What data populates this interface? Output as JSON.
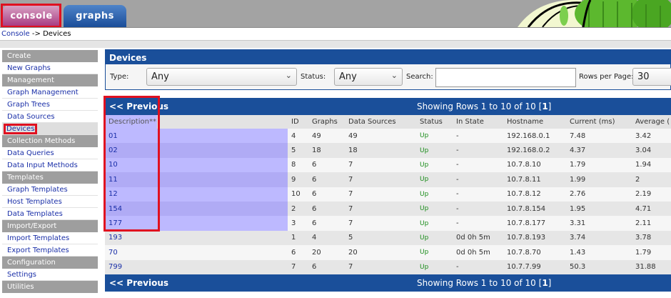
{
  "tabs": [
    {
      "label": "console",
      "active": true
    },
    {
      "label": "graphs",
      "active": false
    }
  ],
  "breadcrumb": {
    "root": "Console",
    "separator": "->",
    "current": "Devices"
  },
  "sidebar": [
    {
      "type": "header",
      "label": "Create"
    },
    {
      "type": "item",
      "label": "New Graphs"
    },
    {
      "type": "header",
      "label": "Management"
    },
    {
      "type": "item",
      "label": "Graph Management"
    },
    {
      "type": "item",
      "label": "Graph Trees"
    },
    {
      "type": "item",
      "label": "Data Sources"
    },
    {
      "type": "item",
      "label": "Devices",
      "active": true
    },
    {
      "type": "header",
      "label": "Collection Methods"
    },
    {
      "type": "item",
      "label": "Data Queries"
    },
    {
      "type": "item",
      "label": "Data Input Methods"
    },
    {
      "type": "header",
      "label": "Templates"
    },
    {
      "type": "item",
      "label": "Graph Templates"
    },
    {
      "type": "item",
      "label": "Host Templates"
    },
    {
      "type": "item",
      "label": "Data Templates"
    },
    {
      "type": "header",
      "label": "Import/Export"
    },
    {
      "type": "item",
      "label": "Import Templates"
    },
    {
      "type": "item",
      "label": "Export Templates"
    },
    {
      "type": "header",
      "label": "Configuration"
    },
    {
      "type": "item",
      "label": "Settings"
    },
    {
      "type": "header",
      "label": "Utilities"
    }
  ],
  "filter": {
    "title": "Devices",
    "type_label": "Type:",
    "type_value": "Any",
    "status_label": "Status:",
    "status_value": "Any",
    "search_label": "Search:",
    "search_value": "",
    "rows_label": "Rows per Page:",
    "rows_value": "30"
  },
  "nav": {
    "previous": "<< Previous",
    "showing_prefix": "Showing Rows 1 to 10 of 10 [",
    "page": "1",
    "showing_suffix": "]"
  },
  "table": {
    "columns": [
      "Description**",
      "ID",
      "Graphs",
      "Data Sources",
      "Status",
      "In State",
      "Hostname",
      "Current (ms)",
      "Average ("
    ],
    "rows": [
      [
        "01",
        "4",
        "49",
        "49",
        "Up",
        "-",
        "192.168.0.1",
        "7.48",
        "3.42"
      ],
      [
        "02",
        "5",
        "18",
        "18",
        "Up",
        "-",
        "192.168.0.2",
        "4.37",
        "3.04"
      ],
      [
        "10",
        "8",
        "6",
        "7",
        "Up",
        "-",
        "10.7.8.10",
        "1.79",
        "1.94"
      ],
      [
        "11",
        "9",
        "6",
        "7",
        "Up",
        "-",
        "10.7.8.11",
        "1.99",
        "2"
      ],
      [
        "12",
        "10",
        "6",
        "7",
        "Up",
        "-",
        "10.7.8.12",
        "2.76",
        "2.19"
      ],
      [
        "154",
        "2",
        "6",
        "7",
        "Up",
        "-",
        "10.7.8.154",
        "1.95",
        "4.71"
      ],
      [
        "177",
        "3",
        "6",
        "7",
        "Up",
        "-",
        "10.7.8.177",
        "3.31",
        "2.11"
      ],
      [
        "193",
        "1",
        "4",
        "5",
        "Up",
        "0d 0h 5m",
        "10.7.8.193",
        "3.74",
        "3.78"
      ],
      [
        "70",
        "6",
        "20",
        "20",
        "Up",
        "0d 0h 5m",
        "10.7.8.70",
        "1.43",
        "1.79"
      ],
      [
        "799",
        "7",
        "6",
        "7",
        "Up",
        "-",
        "10.7.7.99",
        "50.3",
        "31.88"
      ]
    ]
  },
  "colors": {
    "accent": "#1a4f9a",
    "highlight": "#e01020",
    "status_up": "#1a8c1a",
    "link": "#1a2fa8"
  }
}
